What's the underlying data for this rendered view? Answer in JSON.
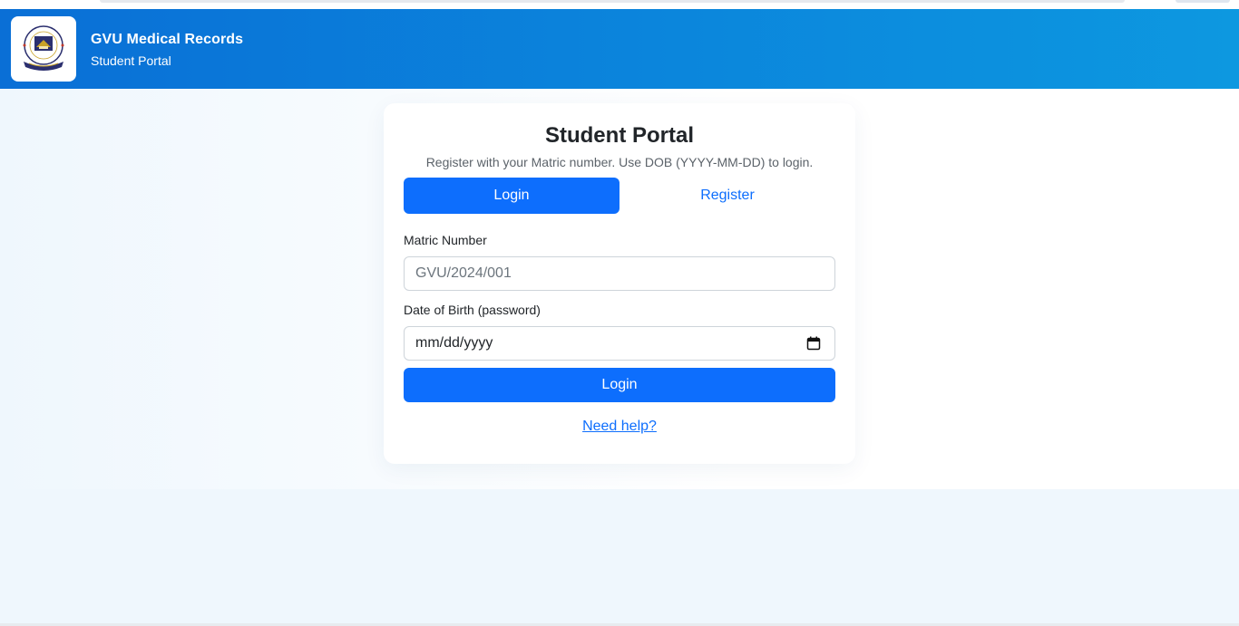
{
  "header": {
    "title": "GVU Medical Records",
    "subtitle": "Student Portal",
    "logo_icon": "university-crest-icon"
  },
  "card": {
    "title": "Student Portal",
    "subtitle": "Register with your Matric number. Use DOB (YYYY-MM-DD) to login.",
    "tabs": [
      {
        "label": "Login",
        "active": true
      },
      {
        "label": "Register",
        "active": false
      }
    ],
    "matric": {
      "label": "Matric Number",
      "placeholder": "GVU/2024/001",
      "value": ""
    },
    "dob": {
      "label": "Date of Birth (password)",
      "placeholder": "mm/dd/yyyy",
      "icon": "calendar-icon"
    },
    "submit_label": "Login",
    "help_link": "Need help?"
  },
  "colors": {
    "primary": "#0d6efd",
    "header_start": "#0a6fd6",
    "header_end": "#0d98e0",
    "page_bg": "#eff7fd"
  }
}
